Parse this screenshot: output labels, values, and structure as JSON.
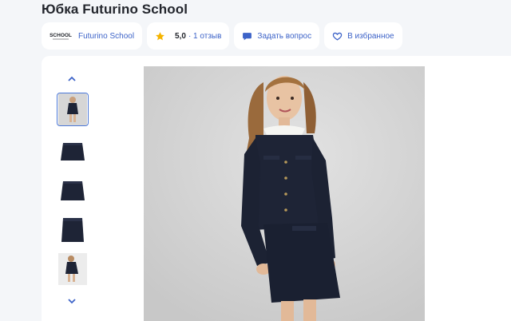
{
  "product": {
    "title": "Юбка Futurino School"
  },
  "brand_chip": {
    "logo_text": "SCHOOL",
    "label": "Futurino School"
  },
  "rating_chip": {
    "rating": "5,0",
    "reviews": "· 1 отзыв",
    "icon": "star-icon",
    "icon_color": "#f5b400"
  },
  "question_chip": {
    "label": "Задать вопрос",
    "icon": "chat-bubble-icon"
  },
  "favorite_chip": {
    "label": "В избранное",
    "icon": "heart-icon"
  },
  "gallery": {
    "thumbnails": [
      {
        "name": "girl-in-uniform",
        "selected": true
      },
      {
        "name": "navy-skirt-front",
        "selected": false
      },
      {
        "name": "navy-skirt-front-2",
        "selected": false
      },
      {
        "name": "navy-skirt-back",
        "selected": false
      },
      {
        "name": "girl-in-uniform-2",
        "selected": false
      }
    ]
  },
  "colors": {
    "accent": "#3d63c8",
    "star": "#f5b400",
    "uniform_navy": "#1e2436"
  }
}
